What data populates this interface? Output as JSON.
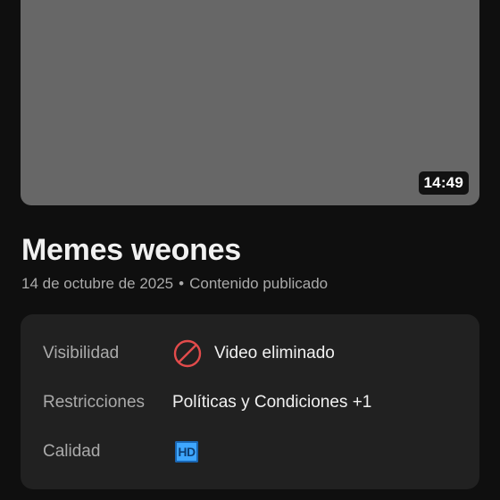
{
  "video": {
    "duration": "14:49",
    "title": "Memes weones",
    "date": "14 de octubre de 2025",
    "separator": "•",
    "status": "Contenido publicado"
  },
  "details": {
    "visibility_label": "Visibilidad",
    "visibility_value": "Video eliminado",
    "visibility_icon": "ban-icon",
    "restrictions_label": "Restricciones",
    "restrictions_value": "Políticas y Condiciones +1",
    "quality_label": "Calidad",
    "quality_value": "HD",
    "quality_icon": "hd-badge-icon"
  },
  "colors": {
    "background": "#0f0f0f",
    "card": "#212121",
    "thumbnail": "#676767",
    "ban_icon": "#e24b4b",
    "hd_badge": "#3ea6ff"
  }
}
